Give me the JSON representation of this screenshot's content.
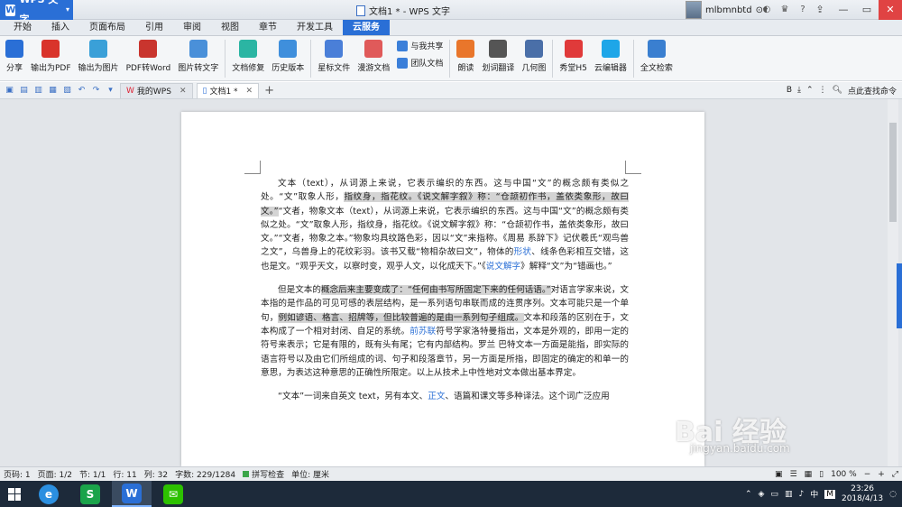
{
  "app": {
    "name": "WPS 文字",
    "logo": "W",
    "window_title": "文档1 * - WPS 文字",
    "user": "mlbmnbtd"
  },
  "menu": [
    "开始",
    "插入",
    "页面布局",
    "引用",
    "审阅",
    "视图",
    "章节",
    "开发工具",
    "云服务"
  ],
  "active_menu": "云服务",
  "ribbon": [
    {
      "label": "分享",
      "icon": "share-icon",
      "color": "#2a6fd6"
    },
    {
      "label": "输出为PDF",
      "icon": "pdf-icon",
      "color": "#d9342b"
    },
    {
      "label": "输出为图片",
      "icon": "image-export-icon",
      "color": "#3aa0d8"
    },
    {
      "label": "PDF转Word",
      "icon": "pdf-to-word-icon",
      "color": "#c9352e"
    },
    {
      "label": "图片转文字",
      "icon": "ocr-icon",
      "color": "#4a90d9"
    },
    {
      "label": "文档修复",
      "icon": "repair-icon",
      "color": "#2bb5a3"
    },
    {
      "label": "历史版本",
      "icon": "history-icon",
      "color": "#3f8fdc"
    },
    {
      "label": "星标文件",
      "icon": "star-folder-icon",
      "color": "#4a7fd8"
    },
    {
      "label": "漫游文档",
      "icon": "roaming-icon",
      "color": "#e05a5a"
    },
    {
      "label": "朗读",
      "icon": "read-aloud-icon",
      "color": "#e9762b"
    },
    {
      "label": "划词翻译",
      "icon": "translate-icon",
      "color": "#555555"
    },
    {
      "label": "几何图",
      "icon": "geometry-icon",
      "color": "#4a6fa8"
    },
    {
      "label": "秀堂H5",
      "icon": "h5-icon",
      "color": "#e03a3a"
    },
    {
      "label": "云编辑器",
      "icon": "cloud-editor-icon",
      "color": "#1ea6e8"
    },
    {
      "label": "全文检索",
      "icon": "fulltext-search-icon",
      "color": "#3a7fd0"
    }
  ],
  "ribbon_stack": {
    "share_with_me": "与我共享",
    "team_docs": "团队文档"
  },
  "tabs": [
    {
      "label": "我的WPS"
    },
    {
      "label": "文档1 *"
    }
  ],
  "search_command": "点此查找命令",
  "document": {
    "p1": [
      {
        "t": "文本（text），从词源上来说，它表示编织的东西。这与中国“文”的概念颇有类似之处。“文”取象人形，",
        "c": ""
      },
      {
        "t": "指纹身，指花纹。《说文解字叙》称：“仓颉初作书，盖依类象形，故曰文。”",
        "c": "hl"
      },
      {
        "t": "“文者，物象文本（text），从词源上来说，它表示编织的东西。这与中国“文”的概念颇有类似之处。“文”取象人形，指纹身，指花纹。《说文解字叙》称：“仓颉初作书，盖依类象形，故曰文。”“文者，物象之本。”物象均具纹路色彩，因以“文”来指称。《周易 系辞下》记伏羲氏“观鸟兽之文”，乌兽身上的花纹彩羽。该书又载“物相杂故曰文”，物体的",
        "c": ""
      },
      {
        "t": "形状",
        "c": "lk"
      },
      {
        "t": "、线条色彩相互交错，这也是文。“观乎天文，以察时变，观乎人文，以化成天下。”《",
        "c": ""
      },
      {
        "t": "说文解字",
        "c": "lk"
      },
      {
        "t": "》解释“文”为“错画也。”",
        "c": ""
      }
    ],
    "p2": [
      {
        "t": "但是文本的",
        "c": ""
      },
      {
        "t": "概念后来主要变成了：“任何由书写所固定下来的任何话语。”",
        "c": "hl"
      },
      {
        "t": "对语言学家来说，文本指的是作品的可见可感的表层结构，是一系列语句串联而成的连贯序列。文本可能只是一个单句，",
        "c": ""
      },
      {
        "t": "例如谚语、格言、招牌等，但比较普遍的是由一系列句子组成。",
        "c": "hl"
      },
      {
        "t": "文本和段落的区别在于，文本构成了一个相对封闭、自足的系统。",
        "c": ""
      },
      {
        "t": "前苏联",
        "c": "lk"
      },
      {
        "t": "符号学家洛特曼指出，文本是外观的，即用一定的符号来表示；它是有限的，既有头有尾；它有内部结构。罗兰 巴特文本一方面是能指，即实际的语言符号以及由它们所组成的词、句子和段落章节，另一方面是所指，即固定的确定的和单一的意思，为表达这种意思的正确性所限定。以上从技术上中性地对文本做出基本界定。",
        "c": ""
      }
    ],
    "p3": [
      {
        "t": "“文本”一词来自英文 text，另有本文、",
        "c": ""
      },
      {
        "t": "正文",
        "c": "lk"
      },
      {
        "t": "、语篇和课文等多种译法。这个词广泛应用",
        "c": ""
      }
    ]
  },
  "status": {
    "page": "页码: 1",
    "pages": "页面: 1/2",
    "section": "节: 1/1",
    "line": "行: 11",
    "column": "列: 32",
    "chars": "字数: 229/1284",
    "spell": "拼写检查",
    "unit": "单位: 厘米",
    "zoom": "100 %"
  },
  "taskbar": {
    "ime": "中",
    "ime_mode": "M",
    "time": "23:26",
    "date": "2018/4/13"
  },
  "watermark": {
    "main": "Bai 经验",
    "sub": "jingyan.baidu.com"
  }
}
